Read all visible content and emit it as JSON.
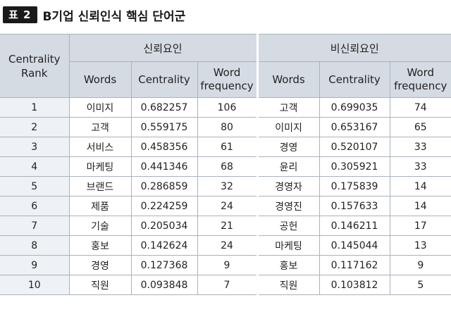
{
  "title": {
    "badge": "표 2",
    "caption": "B기업 신뢰인식 핵심 단어군"
  },
  "table": {
    "rank_header": [
      "Centrality",
      "Rank"
    ],
    "groups": [
      "신뢰요인",
      "비신뢰요인"
    ],
    "sub_headers": {
      "words": "Words",
      "centrality": "Centrality",
      "frequency": [
        "Word",
        "frequency"
      ]
    },
    "rows": [
      {
        "rank": "1",
        "t_word": "이미지",
        "t_cent": "0.682257",
        "t_freq": "106",
        "d_word": "고객",
        "d_cent": "0.699035",
        "d_freq": "74"
      },
      {
        "rank": "2",
        "t_word": "고객",
        "t_cent": "0.559175",
        "t_freq": "80",
        "d_word": "이미지",
        "d_cent": "0.653167",
        "d_freq": "65"
      },
      {
        "rank": "3",
        "t_word": "서비스",
        "t_cent": "0.458356",
        "t_freq": "61",
        "d_word": "경영",
        "d_cent": "0.520107",
        "d_freq": "33"
      },
      {
        "rank": "4",
        "t_word": "마케팅",
        "t_cent": "0.441346",
        "t_freq": "68",
        "d_word": "윤리",
        "d_cent": "0.305921",
        "d_freq": "33"
      },
      {
        "rank": "5",
        "t_word": "브랜드",
        "t_cent": "0.286859",
        "t_freq": "32",
        "d_word": "경영자",
        "d_cent": "0.175839",
        "d_freq": "14"
      },
      {
        "rank": "6",
        "t_word": "제품",
        "t_cent": "0.224259",
        "t_freq": "24",
        "d_word": "경영진",
        "d_cent": "0.157633",
        "d_freq": "14"
      },
      {
        "rank": "7",
        "t_word": "기술",
        "t_cent": "0.205034",
        "t_freq": "21",
        "d_word": "공헌",
        "d_cent": "0.146211",
        "d_freq": "17"
      },
      {
        "rank": "8",
        "t_word": "홍보",
        "t_cent": "0.142624",
        "t_freq": "24",
        "d_word": "마케팅",
        "d_cent": "0.145044",
        "d_freq": "13"
      },
      {
        "rank": "9",
        "t_word": "경영",
        "t_cent": "0.127368",
        "t_freq": "9",
        "d_word": "홍보",
        "d_cent": "0.117162",
        "d_freq": "9"
      },
      {
        "rank": "10",
        "t_word": "직원",
        "t_cent": "0.093848",
        "t_freq": "7",
        "d_word": "직원",
        "d_cent": "0.103812",
        "d_freq": "5"
      }
    ]
  }
}
